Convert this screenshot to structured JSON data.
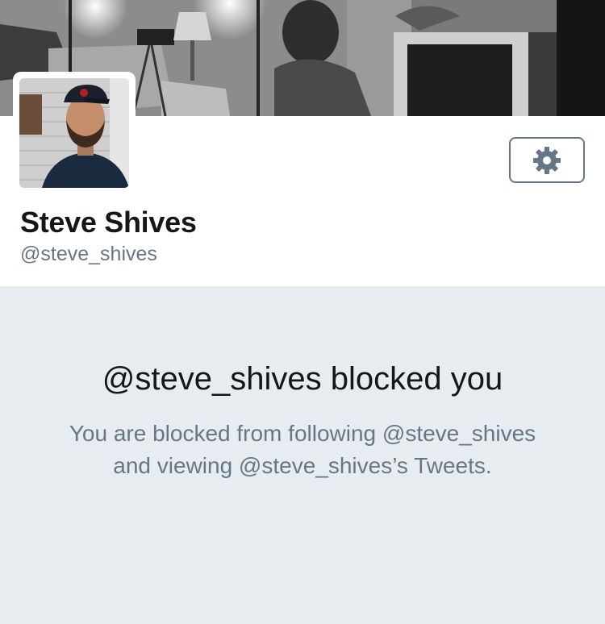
{
  "profile": {
    "display_name": "Steve Shives",
    "handle": "@steve_shives"
  },
  "settings": {
    "icon": "gear-icon"
  },
  "blocked": {
    "title": "@steve_shives blocked you",
    "description": "You are blocked from following @steve_shives and viewing @steve_shives’s Tweets."
  },
  "colors": {
    "panel_background": "#e6ecf0",
    "secondary_text": "#657786",
    "primary_text": "#14171a"
  }
}
